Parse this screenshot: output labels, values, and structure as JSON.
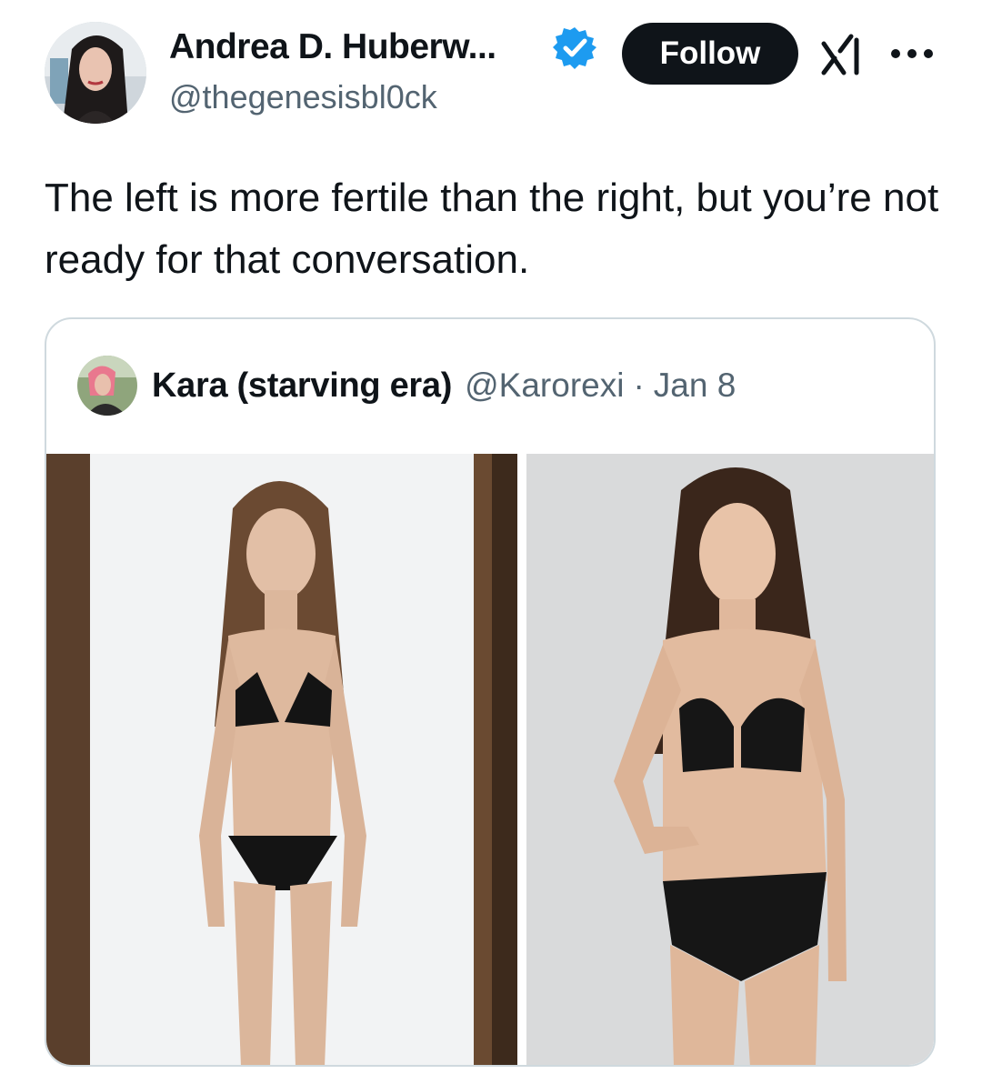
{
  "author": {
    "display_name": "Andrea D. Huberw...",
    "handle": "@thegenesisbl0ck",
    "verified": true,
    "avatar_icon": "profile-photo"
  },
  "actions": {
    "follow_label": "Follow",
    "grok_icon": "grok-icon",
    "more_icon": "more-horizontal-icon"
  },
  "tweet": {
    "text": "The left is more fertile than the right, but you’re not ready for that conversation."
  },
  "quoted_tweet": {
    "display_name": "Kara (starving era)",
    "handle": "@Karorexi",
    "separator": "·",
    "date": "Jan 8",
    "media": [
      {
        "description_icon": "photo-left"
      },
      {
        "description_icon": "photo-right"
      }
    ]
  },
  "colors": {
    "text_primary": "#0f1419",
    "text_secondary": "#536471",
    "verified_blue": "#1d9bf0",
    "follow_bg": "#0f1419",
    "card_border": "#cfd9de"
  }
}
